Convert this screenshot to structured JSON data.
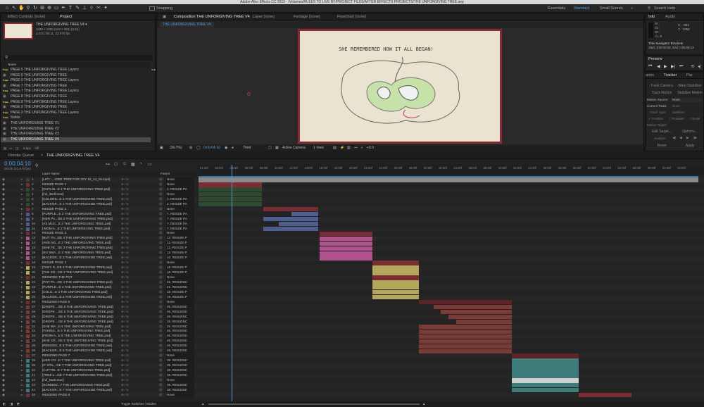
{
  "app": {
    "title": "Adobe After Effects CC 2015 - /Volumes/RULES TO LIVE BY/PROJECT FILES/AFTER EFFECTS PROJECTS/THE UNFORGIVING TREE.aep"
  },
  "toolbar": {
    "tools": [
      "selection-tool",
      "hand-tool",
      "zoom-tool",
      "rotate-tool",
      "camera-tool",
      "pan-behind-tool",
      "mask-tool",
      "pen-tool",
      "type-tool",
      "brush-tool",
      "clone-tool",
      "eraser-tool",
      "roto-tool",
      "puppet-tool"
    ],
    "snapping_label": "Snapping",
    "workspaces": [
      "Essentials",
      "Standard",
      "Small Screen"
    ],
    "active_workspace": "Standard",
    "search_label": "Search Help"
  },
  "project_panel": {
    "tabs": [
      "Effect Controls (none)",
      "Project"
    ],
    "active_tab": "Project",
    "comp_name": "THE UNFORGIVING TREE V4 ▾",
    "comp_info_1": "1920 x 1080  (640 x 360) (0.91)",
    "comp_info_2": "Δ 0:01:06:11, 23.976 fps",
    "column_header": "Name",
    "items": [
      {
        "name": "PAGE 5 THE UNFORGIVING TREE Layers",
        "kind": "folder"
      },
      {
        "name": "PAGE 6 THE UNFORGIVING TREE",
        "kind": "comp"
      },
      {
        "name": "PAGE 6 THE UNFORGIVING TREE Layers",
        "kind": "folder"
      },
      {
        "name": "PAGE 7 THE UNFORGIVING TREE",
        "kind": "comp"
      },
      {
        "name": "PAGE 7 THE UNFORGIVING TREE Layers",
        "kind": "folder"
      },
      {
        "name": "PAGE 8 THE UNFORGIVING TREE",
        "kind": "comp"
      },
      {
        "name": "PAGE 8 THE UNFORGIVING TREE Layers",
        "kind": "folder"
      },
      {
        "name": "PAGE 9 THE UNFORGIVING TREE",
        "kind": "comp"
      },
      {
        "name": "PAGE 9 THE UNFORGIVING TREE Layers",
        "kind": "folder"
      },
      {
        "name": "Solids",
        "kind": "folder"
      },
      {
        "name": "THE UNFORGIVING TREE V1",
        "kind": "comp"
      },
      {
        "name": "THE UNFORGIVING TREE V2",
        "kind": "comp"
      },
      {
        "name": "THE UNFORGIVING TREE V3",
        "kind": "comp"
      },
      {
        "name": "THE UNFORGIVING TREE V4",
        "kind": "comp",
        "selected": true
      }
    ],
    "bpc_label": "8 bpc"
  },
  "viewer": {
    "tabs": [
      "Composition THE UNFORGIVING TREE V4",
      "Layer (none)",
      "Footage (none)",
      "Flowchart (none)"
    ],
    "comp_tab_prefix": "Composition",
    "comp_tab_name": "THE UNFORGIVING TREE V4",
    "active_comp_label": "THE UNFORGIVING TREE V4",
    "artwork_caption": "SHE REMEMBERED HOW IT ALL BEGAN!",
    "bottom_bar": {
      "zoom": "(36.7%)",
      "timecode": "0:00:04:10",
      "resolution": "Third",
      "view": "Active Camera",
      "views": "1 View",
      "exposure": "+0.0"
    }
  },
  "info_panel": {
    "tabs": [
      "Info",
      "Audio"
    ],
    "r": "R :",
    "g": "G :",
    "b": "B :",
    "a": "A : 0",
    "x": "X : -964",
    "y": "Y : 1052",
    "nav_label": "Time Navigator Brackets",
    "nav_range": "Start: 0:00:00:02, End: 0:00:06:13"
  },
  "preview_panel": {
    "title": "Preview"
  },
  "tracker_panel": {
    "tabs": [
      "aries",
      "Tracker",
      "Par"
    ],
    "track_camera": "Track Camera",
    "warp_stabilizer": "Warp Stabilizer",
    "track_motion": "Track Motion",
    "stabilize_motion": "Stabilize Motion",
    "motion_source_label": "Motion Source:",
    "motion_source_value": "None",
    "current_track_label": "Current Track:",
    "current_track_value": "None",
    "track_type_label": "Track Type:",
    "track_type_value": "Stabilize",
    "position": "Position",
    "rotation": "Rotation",
    "scale": "Scale",
    "motion_target": "Motion Target:",
    "edit_target": "Edit Target...",
    "options": "Options...",
    "analyze": "Analyze:",
    "reset": "Reset",
    "apply": "Apply"
  },
  "timeline": {
    "tabs": [
      "Render Queue",
      "THE UNFORGIVING TREE V4"
    ],
    "timecode": "0:00:04:10",
    "frame_info": "00106 (23.976 fps)",
    "col_layer_name": "Layer Name",
    "col_parent": "Parent",
    "toggle_label": "Toggle Switches / Modes",
    "ruler": [
      "01:00f",
      "02:00f",
      "04:00f",
      "06:00f",
      "08:00f",
      "10:00f",
      "12:00f",
      "14:00f",
      "16:00f",
      "18:00f",
      "20:00f",
      "22:00f",
      "24:00f",
      "26:00f",
      "28:00f",
      "30:00f",
      "32:00f",
      "34:00f",
      "36:00f",
      "38:00f",
      "40:00f",
      "42:00f",
      "44:00f",
      "46:00f",
      "48:00f",
      "50:00f",
      "52:00f",
      "54:00f",
      "56:00f",
      "58:00f",
      "00:00f",
      "02:00f",
      "04:00f"
    ],
    "playhead_seconds": 4.4,
    "colors": {
      "red": "#7a2e33",
      "darkred": "#5c2426",
      "green": "#2f4a2f",
      "blue": "#4e5f8e",
      "pink": "#b0528e",
      "yellow": "#b3a85a",
      "brown": "#7a3b34",
      "teal": "#3c7d7c",
      "grey": "#8a8a8a",
      "white": "#cfcfcf"
    },
    "layers": [
      {
        "num": "1",
        "name": "[LIFT -...VING TREE FOR JOY 10_14_16.mp4]",
        "label": "green",
        "parent": "None",
        "start": 0,
        "end": 67,
        "color": "grey"
      },
      {
        "num": "2",
        "name": "RESIZE PAGE 1",
        "label": "red",
        "parent": "None",
        "start": 0,
        "end": 8.5,
        "color": "red"
      },
      {
        "num": "3",
        "name": "[OUTLIN...E 1 THE UNFORGIVING TREE.psd]",
        "label": "green",
        "parent": "2. RESIZE PA",
        "start": 0,
        "end": 8.5,
        "color": "green"
      },
      {
        "num": "4",
        "name": "[ink_itself.mov]",
        "label": "green",
        "parent": "None",
        "start": 0,
        "end": 8.5,
        "color": "green"
      },
      {
        "num": "5",
        "name": "[COLORS...E 1 THE UNFORGIVING TREE.psd]",
        "label": "green",
        "parent": "2. RESIZE PA",
        "start": 0,
        "end": 8.5,
        "color": "green"
      },
      {
        "num": "6",
        "name": "[BACKGR...E 1 THE UNFORGIVING TREE.psd]",
        "label": "green",
        "parent": "2. RESIZE PA",
        "start": 0,
        "end": 8.5,
        "color": "green"
      },
      {
        "num": "7",
        "name": "RESIZE PAGE 2",
        "label": "red",
        "parent": "None",
        "start": 8.7,
        "end": 16,
        "color": "red"
      },
      {
        "num": "8",
        "name": "[PURPLE...E 2 THE UNFORGIVING TREE.psd]",
        "label": "blue",
        "parent": "7. RESIZE PA",
        "start": 12.5,
        "end": 16,
        "color": "blue"
      },
      {
        "num": "9",
        "name": "[HER PA...GE 2 THE UNFORGIVING TREE.psd]",
        "label": "blue",
        "parent": "7. RESIZE PA",
        "start": 8.7,
        "end": 16,
        "color": "blue"
      },
      {
        "num": "10",
        "name": "[AS MUC...E 2 THE UNFORGIVING TREE.psd]",
        "label": "blue",
        "parent": "7. RESIZE PA",
        "start": 10.8,
        "end": 16,
        "color": "blue"
      },
      {
        "num": "11",
        "name": "[ MOM A...E 2 THE UNFORGIVING TREE.psd]",
        "label": "blue",
        "parent": "7. RESIZE PA",
        "start": 8.7,
        "end": 16,
        "color": "blue"
      },
      {
        "num": "12",
        "name": "RESIZE PAGE 3",
        "label": "red",
        "parent": "None",
        "start": 16.2,
        "end": 23.3,
        "color": "red"
      },
      {
        "num": "13",
        "name": "[BUT TH...GE 3 THE UNFORGIVING TREE.psd]",
        "label": "pink",
        "parent": "12. RESIZE P",
        "start": 16.2,
        "end": 23.3,
        "color": "pink"
      },
      {
        "num": "14",
        "name": "[AND NO...E 3 THE UNFORGIVING TREE.psd]",
        "label": "pink",
        "parent": "12. RESIZE P",
        "start": 16.2,
        "end": 23.3,
        "color": "pink"
      },
      {
        "num": "15",
        "name": "[SHE FE...GE 3 THE UNFORGIVING TREE.psd]",
        "label": "pink",
        "parent": "12. RESIZE P",
        "start": 16.2,
        "end": 23.3,
        "color": "pink"
      },
      {
        "num": "16",
        "name": "[SO SMA...E 3 THE UNFORGIVING TREE.psd]",
        "label": "pink",
        "parent": "12. RESIZE P",
        "start": 16.2,
        "end": 23.3,
        "color": "pink"
      },
      {
        "num": "17",
        "name": "[BACKGR...E 3 THE UNFORGIVING TREE.psd]",
        "label": "pink",
        "parent": "12. RESIZE P",
        "start": 16.2,
        "end": 23.3,
        "color": "pink"
      },
      {
        "num": "18",
        "name": "RESIZE PAGE 4",
        "label": "red",
        "parent": "None",
        "start": 23.3,
        "end": 29.5,
        "color": "red"
      },
      {
        "num": "19",
        "name": "[THEY P...GE 4 THE UNFORGIVING TREE.psd]",
        "label": "yellow",
        "parent": "18. RESIZE P",
        "start": 23.3,
        "end": 29.5,
        "color": "yellow"
      },
      {
        "num": "20",
        "name": "[THE SO...GE 4 THE UNFORGIVING TREE.psd]",
        "label": "yellow",
        "parent": "18. RESIZE P",
        "start": 23.3,
        "end": 29.5,
        "color": "yellow"
      },
      {
        "num": "21",
        "name": "RESIZING THE POT",
        "label": "red",
        "parent": "None",
        "start": 23.3,
        "end": 29.5,
        "color": "red"
      },
      {
        "num": "22",
        "name": "[POT PA...GE 4 THE UNFORGIVING TREE.psd]",
        "label": "yellow",
        "parent": "21. RESIZINC",
        "start": 23.3,
        "end": 29.5,
        "color": "yellow"
      },
      {
        "num": "23",
        "name": "[PURPLE...E 4 THE UNFORGIVING TREE.psd]",
        "label": "yellow",
        "parent": "21. RESIZINC",
        "start": 23.3,
        "end": 29.5,
        "color": "yellow"
      },
      {
        "num": "24",
        "name": "[COLO...E 4 THE UNFORGIVING TREE.psd]",
        "label": "yellow",
        "parent": "18. RESIZE P",
        "start": 23.3,
        "end": 29.5,
        "color": "yellow"
      },
      {
        "num": "25",
        "name": "[BACKGR...E 4 THE UNFORGIVING TREE.psd]",
        "label": "yellow",
        "parent": "18. RESIZE P",
        "start": 23.3,
        "end": 29.5,
        "color": "yellow"
      },
      {
        "num": "26",
        "name": "RESIZING PAGE 6",
        "label": "red",
        "parent": "None",
        "start": 29.5,
        "end": 42,
        "color": "darkred"
      },
      {
        "num": "27",
        "name": "[DROPS ...GE 6 THE UNFORGIVING TREE.psd]",
        "label": "brown",
        "parent": "26. RESIZINC",
        "start": 31.5,
        "end": 42,
        "color": "brown"
      },
      {
        "num": "28",
        "name": "[DROPS ...GE 6 THE UNFORGIVING TREE.psd]",
        "label": "brown",
        "parent": "26. RESIZINC",
        "start": 32.5,
        "end": 42,
        "color": "brown"
      },
      {
        "num": "29",
        "name": "[DROPS ...GE 6 THE UNFORGIVING TREE.psd]",
        "label": "brown",
        "parent": "26. RESIZINC",
        "start": 33.5,
        "end": 42,
        "color": "brown"
      },
      {
        "num": "30",
        "name": "[DROPS ...GE 6 THE UNFORGIVING TREE.psd]",
        "label": "brown",
        "parent": "26. RESIZINC",
        "start": 34.5,
        "end": 42,
        "color": "brown"
      },
      {
        "num": "31",
        "name": "[SHE WA...E 6 THE UNFORGIVING TREE.psd]",
        "label": "brown",
        "parent": "26. RESIZINC",
        "start": 29.5,
        "end": 42,
        "color": "brown"
      },
      {
        "num": "32",
        "name": "[TAKING...E 6 THE UNFORGIVING TREE.psd]",
        "label": "brown",
        "parent": "26. RESIZINC",
        "start": 29.5,
        "end": 42,
        "color": "brown"
      },
      {
        "num": "33",
        "name": "[FROM A...E 6 THE UNFORGIVING TREE.psd]",
        "label": "brown",
        "parent": "26. RESIZINC",
        "start": 29.5,
        "end": 42,
        "color": "brown"
      },
      {
        "num": "34",
        "name": "[SHE CR...GE 6 THE UNFORGIVING TREE.psd]",
        "label": "brown",
        "parent": "26. RESIZINC",
        "start": 29.5,
        "end": 42,
        "color": "brown"
      },
      {
        "num": "35",
        "name": "[PERSON...E 6 THE UNFORGIVING TREE.psd]",
        "label": "brown",
        "parent": "26. RESIZINC",
        "start": 29.5,
        "end": 42,
        "color": "brown"
      },
      {
        "num": "36",
        "name": "[BACKGR...E 6 THE UNFORGIVING TREE.psd]",
        "label": "brown",
        "parent": "26. RESIZINC",
        "start": 29.5,
        "end": 42,
        "color": "brown"
      },
      {
        "num": "37",
        "name": "RESIZING PAGE 7",
        "label": "red",
        "parent": "None",
        "start": 42,
        "end": 51,
        "color": "darkred"
      },
      {
        "num": "38",
        "name": "[HER CO...E 7 THE UNFORGIVING TREE.psd]",
        "label": "teal",
        "parent": "38. RESIZINC",
        "start": 42,
        "end": 51,
        "color": "teal"
      },
      {
        "num": "39",
        "name": "[IT STIL...GE 7 THE UNFORGIVING TREE.psd]",
        "label": "teal",
        "parent": "38. RESIZINC",
        "start": 42,
        "end": 51,
        "color": "teal"
      },
      {
        "num": "40",
        "name": "[CUTTIN...E 7 THE UNFORGIVING TREE.psd]",
        "label": "teal",
        "parent": "38. RESIZINC",
        "start": 42,
        "end": 51,
        "color": "teal"
      },
      {
        "num": "41",
        "name": "[TREE L...GE 7 THE UNFORGIVING TREE.psd]",
        "label": "teal",
        "parent": "38. RESIZINC",
        "start": 42,
        "end": 51,
        "color": "teal"
      },
      {
        "num": "42",
        "name": "[ink_Dark.mov]",
        "label": "teal",
        "parent": "None",
        "start": 42,
        "end": 51,
        "color": "white"
      },
      {
        "num": "43",
        "name": "[SCREEN/...7 THE UNFORGIVING TREE.psd]",
        "label": "teal",
        "parent": "38. RESIZINC",
        "start": 42,
        "end": 51,
        "color": "teal"
      },
      {
        "num": "44",
        "name": "[BACKGR...E 7 THE UNFORGIVING TREE.psd]",
        "label": "teal",
        "parent": "38. RESIZINC",
        "start": 42,
        "end": 51,
        "color": "teal"
      },
      {
        "num": "45",
        "name": "RESIZING PAGE 8",
        "label": "red",
        "parent": "None",
        "start": 51,
        "end": 58,
        "color": "red"
      }
    ]
  }
}
